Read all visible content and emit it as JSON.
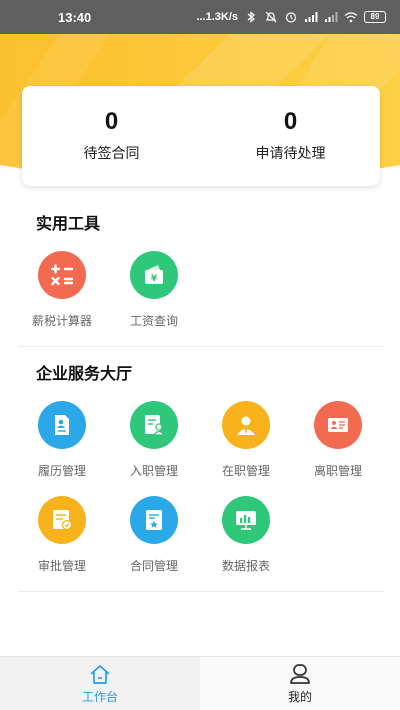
{
  "status_bar": {
    "time": "13:40",
    "network_speed": "...1.3K/s",
    "battery": "89"
  },
  "stats": [
    {
      "value": "0",
      "label": "待签合同"
    },
    {
      "value": "0",
      "label": "申请待处理"
    }
  ],
  "practical_tools": {
    "title": "实用工具",
    "items": [
      {
        "label": "薪税计算器",
        "icon": "calculator-icon",
        "color": "#f26b50"
      },
      {
        "label": "工资查询",
        "icon": "wallet-icon",
        "color": "#2fc77a"
      }
    ]
  },
  "service_hall": {
    "title": "企业服务大厅",
    "items": [
      {
        "label": "履历管理",
        "icon": "resume-icon",
        "color": "#2aa8e8"
      },
      {
        "label": "入职管理",
        "icon": "onboarding-icon",
        "color": "#2fc77a"
      },
      {
        "label": "在职管理",
        "icon": "employee-icon",
        "color": "#f7b21c"
      },
      {
        "label": "离职管理",
        "icon": "resignation-icon",
        "color": "#f26b50"
      },
      {
        "label": "审批管理",
        "icon": "approval-icon",
        "color": "#f7b21c"
      },
      {
        "label": "合同管理",
        "icon": "contract-icon",
        "color": "#2aa8e8"
      },
      {
        "label": "数据报表",
        "icon": "report-icon",
        "color": "#2fc77a"
      }
    ]
  },
  "bottom_nav": [
    {
      "label": "工作台",
      "icon": "home-icon",
      "active": true
    },
    {
      "label": "我的",
      "icon": "profile-icon",
      "active": false
    }
  ],
  "colors": {
    "header_yellow": "#fbc43a",
    "accent_blue": "#2c9be6"
  }
}
